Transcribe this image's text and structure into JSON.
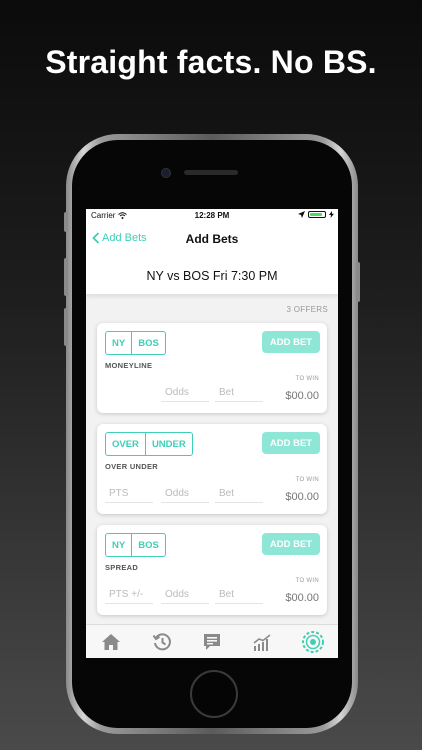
{
  "headline": "Straight facts. No BS.",
  "status_bar": {
    "carrier": "Carrier",
    "time": "12:28 PM"
  },
  "nav": {
    "back_label": "Add Bets",
    "title": "Add Bets"
  },
  "game": {
    "title": "NY vs BOS Fri 7:30 PM"
  },
  "offers_count": "3 OFFERS",
  "cards": [
    {
      "options": [
        "NY",
        "BOS"
      ],
      "type_label": "MONEYLINE",
      "button_label": "ADD BET",
      "fields": {
        "odds": "Odds",
        "bet": "Bet"
      },
      "towin_label": "TO WIN",
      "towin_value": "$00.00"
    },
    {
      "options": [
        "OVER",
        "UNDER"
      ],
      "type_label": "OVER UNDER",
      "button_label": "ADD BET",
      "fields": {
        "pts": "PTS",
        "odds": "Odds",
        "bet": "Bet"
      },
      "towin_label": "TO WIN",
      "towin_value": "$00.00"
    },
    {
      "options": [
        "NY",
        "BOS"
      ],
      "type_label": "SPREAD",
      "button_label": "ADD BET",
      "fields": {
        "pts": "PTS +/-",
        "odds": "Odds",
        "bet": "Bet"
      },
      "towin_label": "TO WIN",
      "towin_value": "$00.00"
    }
  ],
  "tabs": [
    {
      "icon": "home-icon",
      "active": false
    },
    {
      "icon": "history-icon",
      "active": false
    },
    {
      "icon": "message-icon",
      "active": false
    },
    {
      "icon": "chart-icon",
      "active": false
    },
    {
      "icon": "poker-chip-icon",
      "active": true
    }
  ],
  "colors": {
    "accent": "#3fcfb4",
    "button": "#8ee6d6",
    "battery": "#4cd964"
  },
  "battery_level": 0.85
}
